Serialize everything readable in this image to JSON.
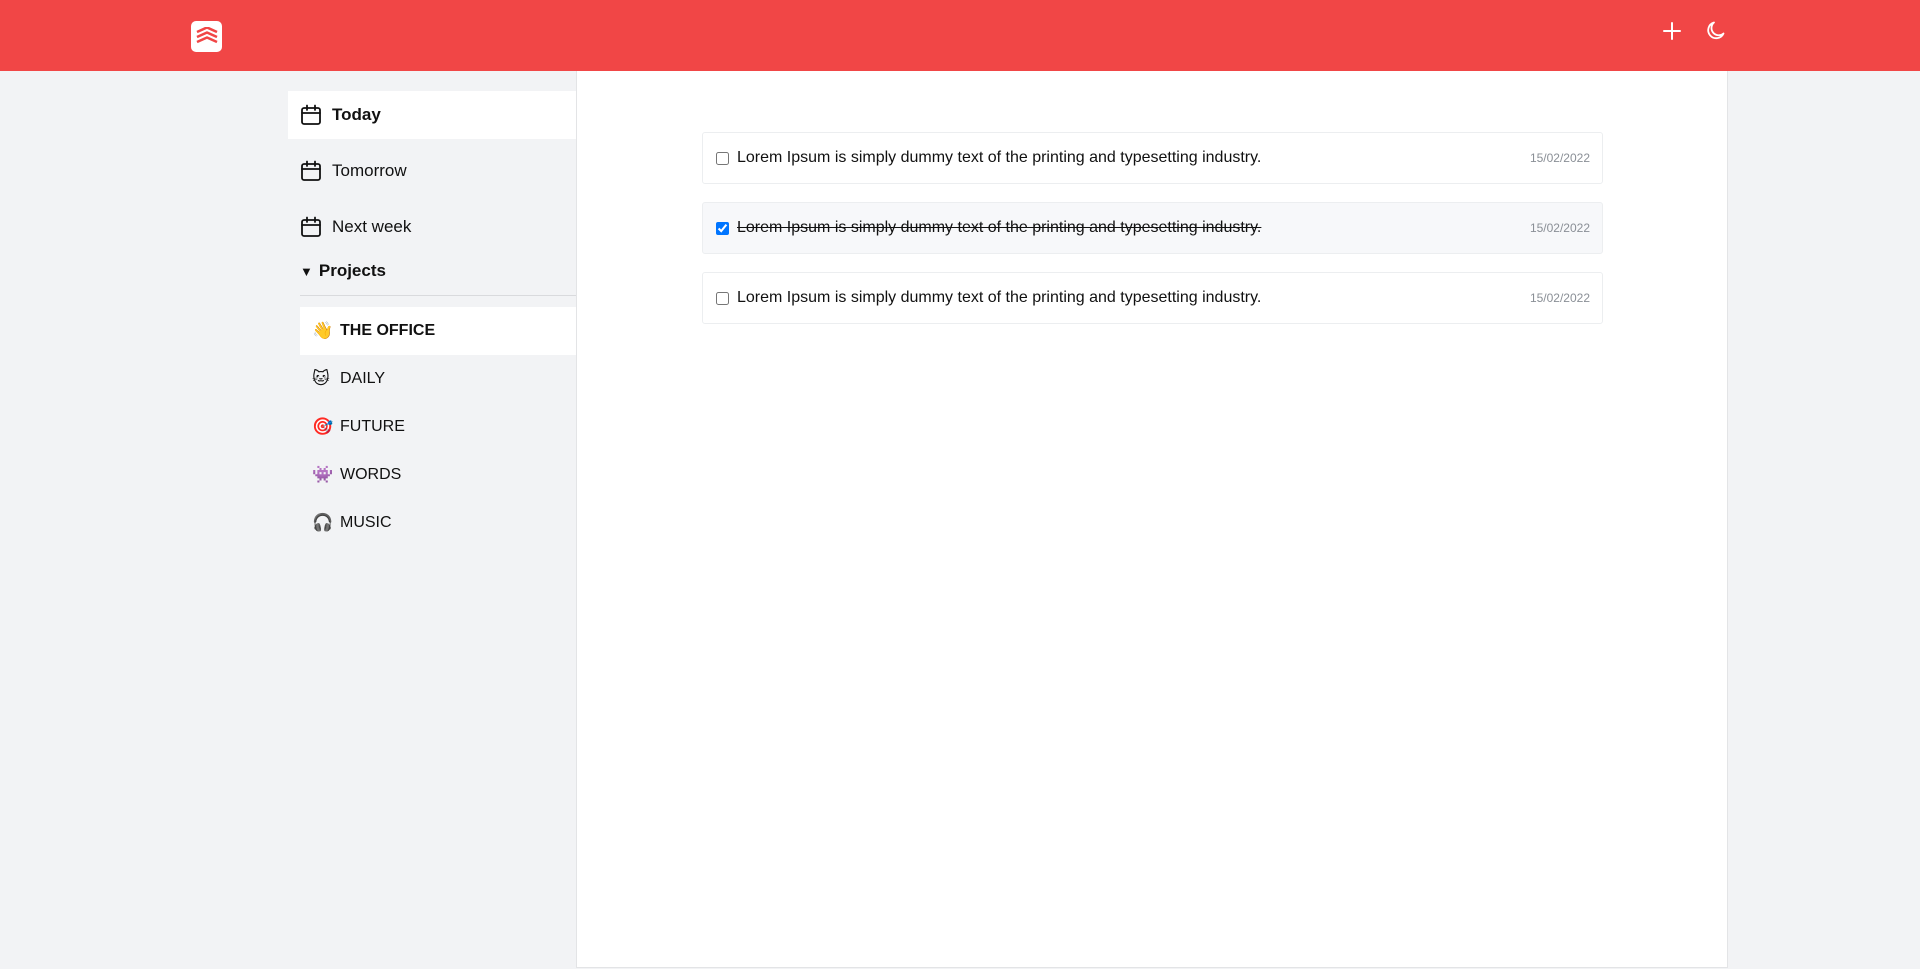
{
  "colors": {
    "brand": "#f14646",
    "sidebar_bg": "#f2f3f5",
    "main_bg": "#ffffff"
  },
  "header": {
    "logo_icon": "todoist-logo-icon",
    "add_icon": "plus-icon",
    "theme_icon": "moon-icon"
  },
  "sidebar": {
    "items": [
      {
        "label": "Today",
        "icon": "calendar-icon",
        "active": true
      },
      {
        "label": "Tomorrow",
        "icon": "calendar-icon",
        "active": false
      },
      {
        "label": "Next week",
        "icon": "calendar-icon",
        "active": false
      }
    ],
    "projects_label": "Projects",
    "projects": [
      {
        "emoji": "👋",
        "label": "THE OFFICE",
        "active": true
      },
      {
        "emoji": "🐱",
        "label": "DAILY",
        "active": false
      },
      {
        "emoji": "🎯",
        "label": "FUTURE",
        "active": false
      },
      {
        "emoji": "👾",
        "label": "WORDS",
        "active": false
      },
      {
        "emoji": "🎧",
        "label": "MUSIC",
        "active": false
      }
    ]
  },
  "tasks": [
    {
      "text": "Lorem Ipsum is simply dummy text of the printing and typesetting industry.",
      "date": "15/02/2022",
      "done": false
    },
    {
      "text": "Lorem Ipsum is simply dummy text of the printing and typesetting industry.",
      "date": "15/02/2022",
      "done": true
    },
    {
      "text": "Lorem Ipsum is simply dummy text of the printing and typesetting industry.",
      "date": "15/02/2022",
      "done": false
    }
  ]
}
